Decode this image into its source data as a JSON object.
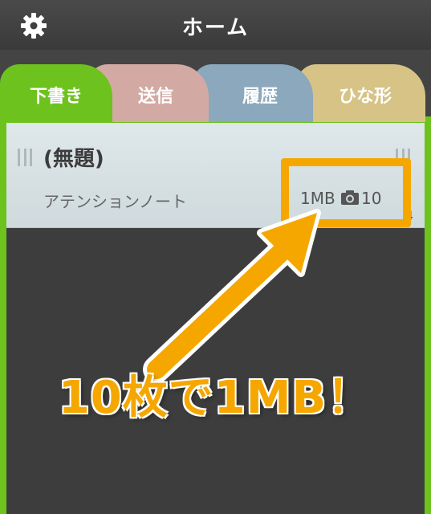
{
  "navbar": {
    "title": "ホーム",
    "settings_icon": "gear-icon"
  },
  "tabs": [
    {
      "label": "下書き",
      "color": "#6ec21e",
      "active": true
    },
    {
      "label": "送信",
      "color": "#d3aaa3",
      "active": false
    },
    {
      "label": "履歴",
      "color": "#8ba8bd",
      "active": false
    },
    {
      "label": "ひな形",
      "color": "#d6c385",
      "active": false
    }
  ],
  "list": {
    "items": [
      {
        "title": "(無題)",
        "subtitle": "アテンションノート",
        "size": "1MB",
        "photo_icon": "camera-icon",
        "photo_count": "10",
        "date_fragment": "4"
      }
    ]
  },
  "annotation": {
    "caption": "10枚で1MB！",
    "color": "#f5a700"
  }
}
